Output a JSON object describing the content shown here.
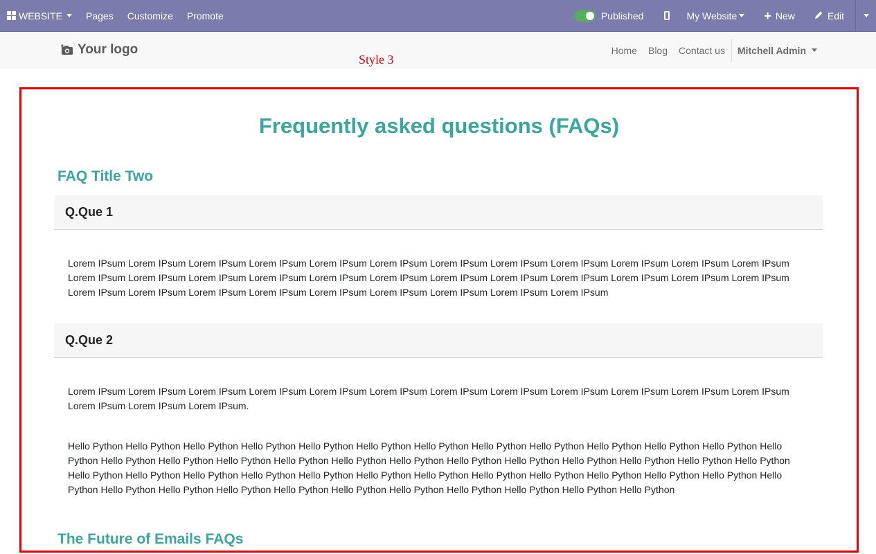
{
  "adminbar": {
    "website_label": "WEBSITE",
    "pages_label": "Pages",
    "customize_label": "Customize",
    "promote_label": "Promote",
    "published_label": "Published",
    "my_website_label": "My Website",
    "new_label": "New",
    "edit_label": "Edit"
  },
  "header": {
    "logo_text": "Your logo",
    "nav": {
      "home": "Home",
      "blog": "Blog",
      "contact": "Contact us"
    },
    "user_name": "Mitchell Admin"
  },
  "style_label": "Style 3",
  "faq": {
    "heading": "Frequently asked questions (FAQs)",
    "section_one_title": "FAQ Title Two",
    "questions": [
      {
        "question": "Q.Que 1",
        "answer": "Lorem IPsum Lorem IPsum Lorem IPsum Lorem IPsum Lorem IPsum Lorem IPsum Lorem IPsum Lorem IPsum Lorem IPsum Lorem IPsum Lorem IPsum Lorem IPsum Lorem IPsum Lorem IPsum Lorem IPsum Lorem IPsum Lorem IPsum Lorem IPsum Lorem IPsum Lorem IPsum Lorem IPsum Lorem IPsum Lorem IPsum Lorem IPsum Lorem IPsum Lorem IPsum Lorem IPsum Lorem IPsum Lorem IPsum Lorem IPsum Lorem IPsum Lorem IPsum Lorem IPsum"
      },
      {
        "question": "Q.Que 2",
        "answer": "Lorem IPsum Lorem IPsum Lorem IPsum Lorem IPsum Lorem IPsum Lorem IPsum Lorem IPsum Lorem IPsum Lorem IPsum Lorem IPsum Lorem IPsum Lorem IPsum Lorem IPsum Lorem IPsum Lorem IPsum.",
        "answer_extra": "Hello Python Hello Python Hello Python Hello Python Hello Python Hello Python Hello Python Hello Python Hello Python Hello Python Hello Python Hello Python Hello Python Hello Python Hello Python Hello Python Hello Python Hello Python Hello Python Hello Python Hello Python Hello Python Hello Python Hello Python Hello Python Hello Python Hello Python Hello Python Hello Python Hello Python Hello Python Hello Python Hello Python Hello Python Hello Python Hello Python Hello Python Hello Python Hello Python Hello Python Hello Python Hello Python Hello Python Hello Python Hello Python Hello Python Hello Python Hello Python"
      }
    ],
    "section_two_title": "The Future of Emails FAQs"
  },
  "colors": {
    "adminbar_bg": "#7c7bad",
    "accent_teal": "#3aa6a0",
    "highlight_red": "#ee0000",
    "toggle_green": "#52b15a"
  }
}
